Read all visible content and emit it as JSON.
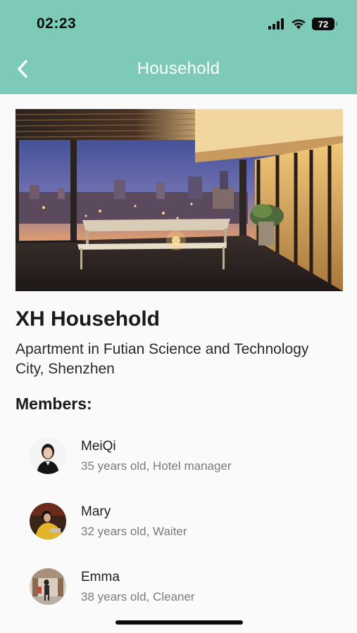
{
  "status_bar": {
    "time": "02:23",
    "battery": "72",
    "battery_level": 0.72,
    "icons": [
      "signal-icon",
      "wifi-icon",
      "battery-icon"
    ]
  },
  "nav": {
    "back_icon": "chevron-left-icon",
    "title": "Household"
  },
  "household": {
    "name": "XH Household",
    "description": "Apartment in Futian Science and Technology City, Shenzhen"
  },
  "members_heading": "Members:",
  "members": [
    {
      "name": "MeiQi",
      "info": "35 years old, Hotel manager"
    },
    {
      "name": "Mary",
      "info": "32 years old, Waiter"
    },
    {
      "name": "Emma",
      "info": "38 years old, Cleaner"
    }
  ],
  "colors": {
    "header_bg": "#7ccab7",
    "header_text": "#ffffff",
    "page_bg": "#fafafa",
    "secondary_text": "#7a7a7a"
  }
}
